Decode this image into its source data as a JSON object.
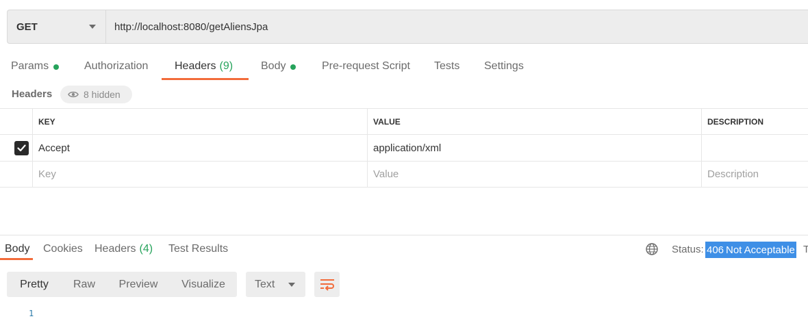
{
  "request": {
    "method": "GET",
    "url": "http://localhost:8080/getAliensJpa"
  },
  "request_tabs": [
    {
      "label": "Params",
      "count": "",
      "dot": true
    },
    {
      "label": "Authorization",
      "count": "",
      "dot": false
    },
    {
      "label": "Headers",
      "count": "(9)",
      "dot": false,
      "active": true
    },
    {
      "label": "Body",
      "count": "",
      "dot": true
    },
    {
      "label": "Pre-request Script",
      "count": "",
      "dot": false
    },
    {
      "label": "Tests",
      "count": "",
      "dot": false
    },
    {
      "label": "Settings",
      "count": "",
      "dot": false
    }
  ],
  "headers_section": {
    "title": "Headers",
    "hidden_label": "8 hidden"
  },
  "table": {
    "columns": [
      "KEY",
      "VALUE",
      "DESCRIPTION"
    ],
    "rows": [
      {
        "checked": true,
        "key": "Accept",
        "value": "application/xml",
        "description": ""
      }
    ],
    "placeholders": {
      "key": "Key",
      "value": "Value",
      "description": "Description"
    }
  },
  "response_tabs": [
    {
      "label": "Body",
      "count": "",
      "active": true
    },
    {
      "label": "Cookies",
      "count": ""
    },
    {
      "label": "Headers",
      "count": "(4)"
    },
    {
      "label": "Test Results",
      "count": ""
    }
  ],
  "status": {
    "label": "Status:",
    "code": "406",
    "text": "Not Acceptable",
    "truncated": "T"
  },
  "view_modes": [
    "Pretty",
    "Raw",
    "Preview",
    "Visualize"
  ],
  "format": "Text",
  "line_numbers": [
    "1"
  ],
  "colors": {
    "accent": "#f26b3a",
    "success": "#26a35b",
    "selection": "#3e8fe6"
  }
}
